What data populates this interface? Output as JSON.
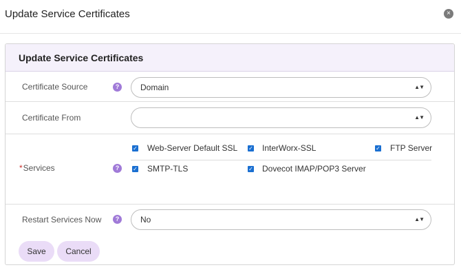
{
  "modal": {
    "title": "Update Service Certificates"
  },
  "panel": {
    "heading": "Update Service Certificates"
  },
  "form": {
    "certificate_source": {
      "label": "Certificate Source",
      "value": "Domain"
    },
    "certificate_from": {
      "label": "Certificate From",
      "value": ""
    },
    "services": {
      "required_mark": "*",
      "label": "Services",
      "items": [
        {
          "label": "Web-Server Default SSL",
          "checked": true
        },
        {
          "label": "InterWorx-SSL",
          "checked": true
        },
        {
          "label": "FTP Server",
          "checked": true
        },
        {
          "label": "SMTP-TLS",
          "checked": true
        },
        {
          "label": "Dovecot IMAP/POP3 Server",
          "checked": true
        }
      ]
    },
    "restart_services": {
      "label": "Restart Services Now",
      "value": "No"
    }
  },
  "buttons": {
    "save": "Save",
    "cancel": "Cancel"
  },
  "icons": {
    "help": "?",
    "close": "×",
    "checkmark": "✓",
    "select_arrows": "▲▼"
  },
  "colors": {
    "accent": "#a07ad8",
    "button_bg": "#eadcf7",
    "checkbox": "#1a6fd1",
    "header_bg": "#f5f1fb"
  }
}
